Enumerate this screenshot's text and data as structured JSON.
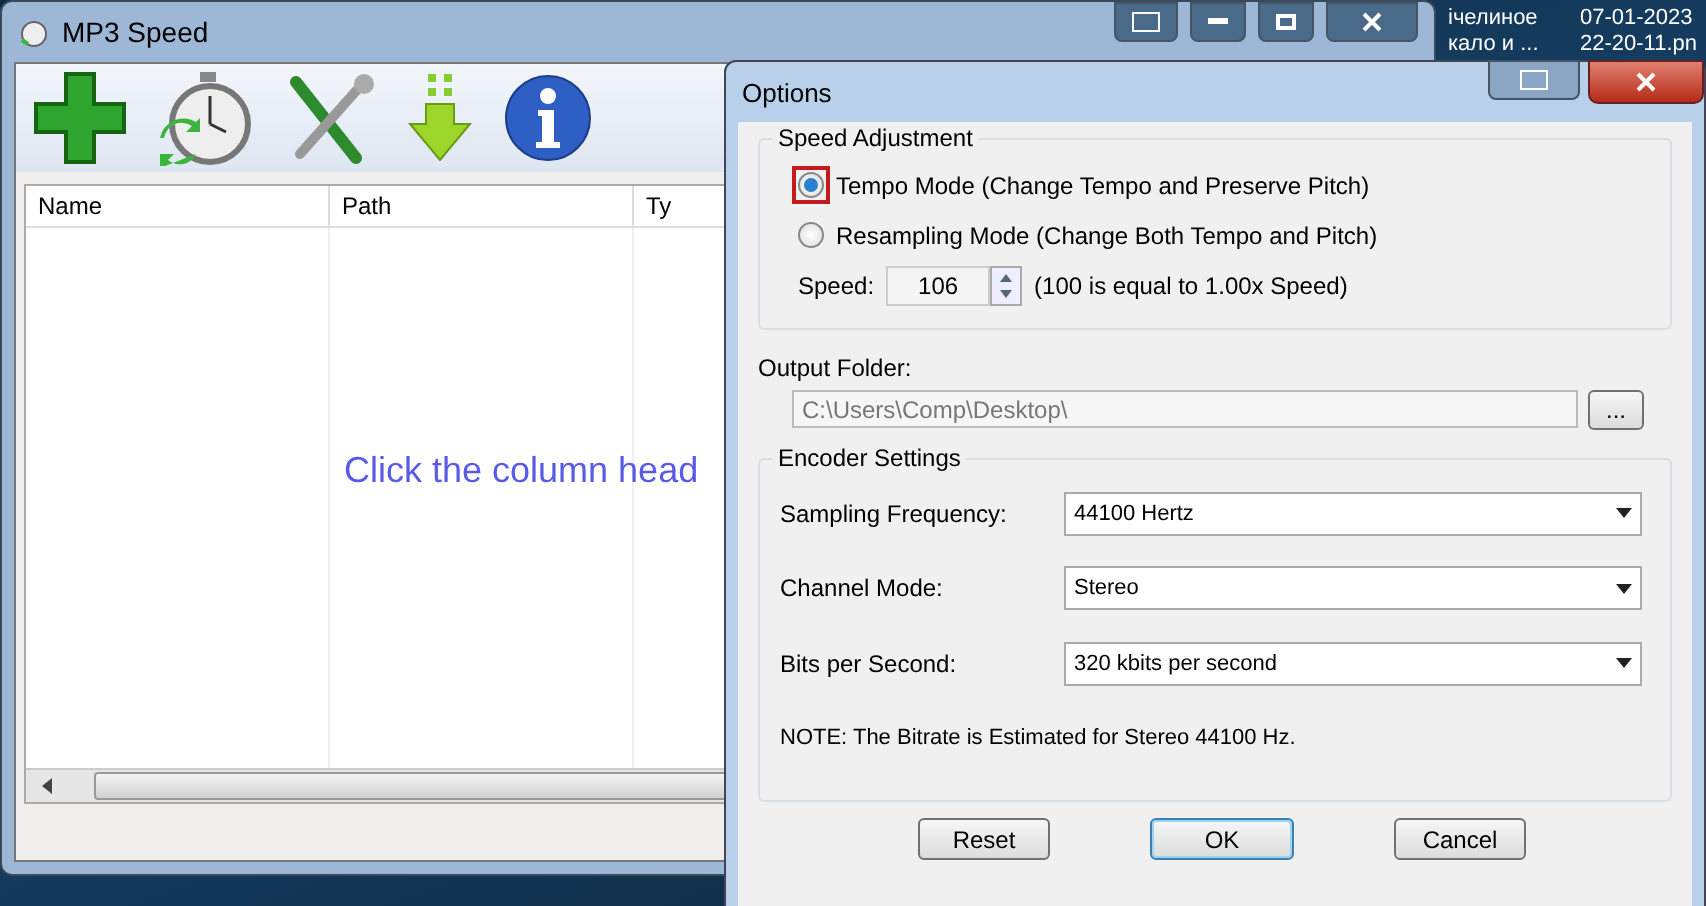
{
  "desktop_labels": [
    {
      "text": "ічелиное"
    },
    {
      "text": "07-01-2023"
    },
    {
      "text": "кало и ..."
    },
    {
      "text": "22-20-11.pn"
    }
  ],
  "main_window": {
    "title": "MP3 Speed",
    "toolbar": [
      {
        "kind": "add"
      },
      {
        "kind": "stopwatch"
      },
      {
        "kind": "tools"
      },
      {
        "kind": "download"
      },
      {
        "kind": "info"
      }
    ],
    "columns": [
      "Name",
      "Path",
      "Ty"
    ],
    "empty_message": "Click the column head"
  },
  "options_dialog": {
    "title": "Options",
    "speed_group": {
      "label": "Speed Adjustment",
      "modes": [
        {
          "label": "Tempo Mode (Change Tempo and Preserve Pitch)",
          "selected": true,
          "highlighted": true
        },
        {
          "label": "Resampling Mode (Change Both Tempo and Pitch)",
          "selected": false,
          "highlighted": false
        }
      ],
      "speed_label": "Speed:",
      "speed_value": "106",
      "speed_note": "(100 is equal to 1.00x Speed)"
    },
    "output_folder": {
      "label": "Output Folder:",
      "path": "C:\\Users\\Comp\\Desktop\\",
      "browse": "..."
    },
    "encoder_group": {
      "label": "Encoder Settings",
      "rows": [
        {
          "label": "Sampling Frequency:",
          "value": "44100 Hertz"
        },
        {
          "label": "Channel Mode:",
          "value": "Stereo"
        },
        {
          "label": "Bits per Second:",
          "value": "320 kbits per second"
        }
      ],
      "note": "NOTE: The Bitrate is Estimated  for Stereo 44100 Hz."
    },
    "buttons": [
      {
        "label": "Reset",
        "default": false
      },
      {
        "label": "OK",
        "default": true
      },
      {
        "label": "Cancel",
        "default": false
      }
    ]
  }
}
